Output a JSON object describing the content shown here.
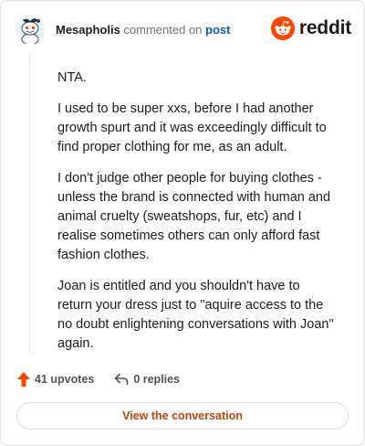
{
  "comment": {
    "author": "Mesapholis",
    "action_text": "commented on",
    "target_link": "post",
    "paragraphs": [
      "NTA.",
      "I used to be super xxs, before I had another growth spurt and it was exceedingly difficult to find proper clothing for me, as an adult.",
      "I don't judge other people for buying clothes - unless the brand is connected with human and animal cruelty (sweatshops, fur, etc) and I realise sometimes others can only afford fast fashion clothes.",
      "Joan is entitled and you shouldn't have to return your dress just to \"aquire access to the no doubt enlightening conversations with Joan\" again."
    ]
  },
  "brand": {
    "wordmark": "reddit",
    "logo_icon": "reddit-snoo-icon",
    "accent_color": "#ff4500"
  },
  "stats": {
    "upvotes_label": "41 upvotes",
    "upvote_icon": "upvote-arrow-icon",
    "replies_label": "0 replies",
    "reply_icon": "reply-arrow-icon"
  },
  "cta": {
    "label": "View the conversation"
  },
  "colors": {
    "link_blue": "#0b5cad",
    "cta_text": "#c0440b",
    "border": "#dcdfe3",
    "muted_text": "#6f747a"
  }
}
